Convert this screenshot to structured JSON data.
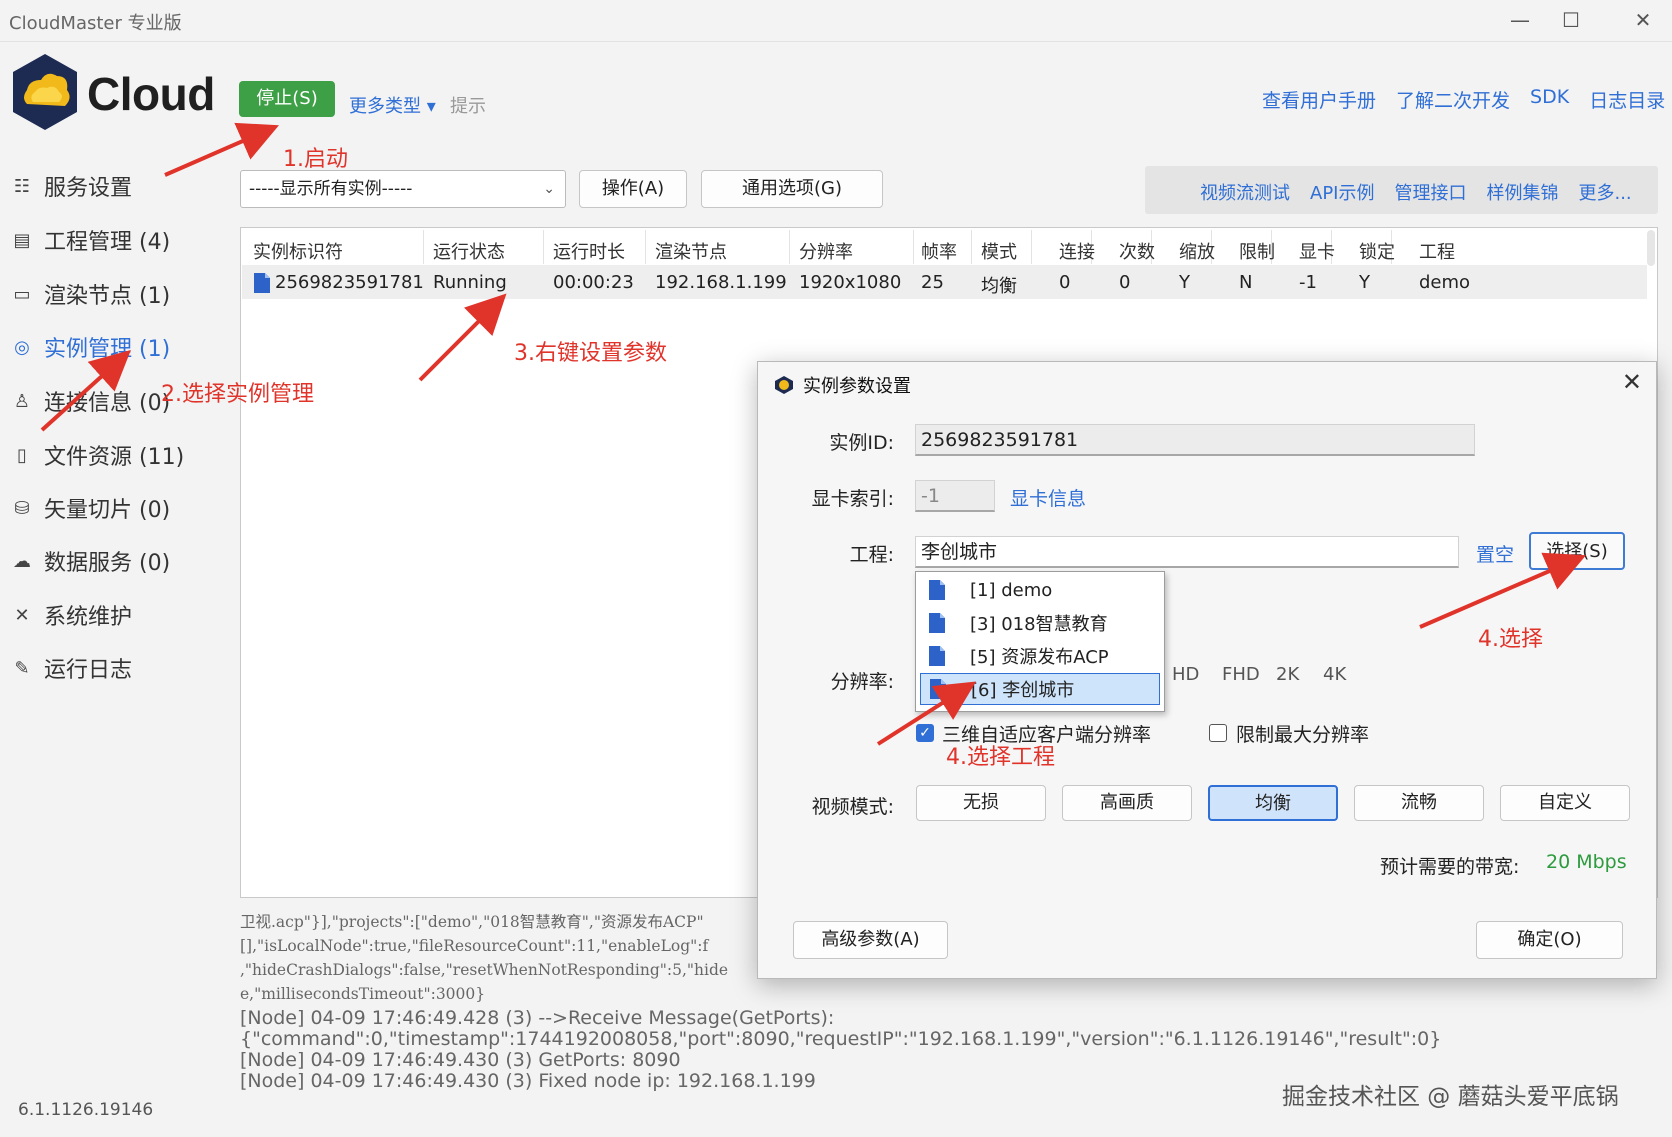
{
  "window": {
    "title": "CloudMaster 专业版",
    "controls": {
      "minimize": "—",
      "maximize": "☐",
      "close": "✕"
    }
  },
  "header": {
    "logo_text": "Cloud",
    "stop_label": "停止(S)",
    "more_types": "更多类型 ▾",
    "hint": "提示",
    "links": [
      "查看用户手册",
      "了解二次开发",
      "SDK",
      "日志目录"
    ]
  },
  "sidebar": {
    "items": [
      {
        "label": "服务设置",
        "icon": "settings-list-icon"
      },
      {
        "label": "工程管理 (4)",
        "icon": "document-icon"
      },
      {
        "label": "渲染节点 (1)",
        "icon": "monitor-icon"
      },
      {
        "label": "实例管理 (1)",
        "icon": "instance-icon",
        "active": true
      },
      {
        "label": "连接信息 (0)",
        "icon": "user-icon"
      },
      {
        "label": "文件资源 (11)",
        "icon": "file-icon"
      },
      {
        "label": "矢量切片 (0)",
        "icon": "database-icon"
      },
      {
        "label": "数据服务 (0)",
        "icon": "cloud-service-icon"
      },
      {
        "label": "系统维护",
        "icon": "tools-icon"
      },
      {
        "label": "运行日志",
        "icon": "log-icon"
      }
    ],
    "version": "6.1.1126.19146"
  },
  "toolbar": {
    "instance_filter": "-----显示所有实例-----",
    "ops_label": "操作(A)",
    "general_label": "通用选项(G)",
    "right_links": [
      "视频流测试",
      "API示例",
      "管理接口",
      "样例集锦",
      "更多..."
    ]
  },
  "table": {
    "headers": [
      "实例标识符",
      "运行状态",
      "运行时长",
      "渲染节点",
      "分辨率",
      "帧率",
      "模式",
      "连接",
      "次数",
      "缩放",
      "限制",
      "显卡",
      "锁定",
      "工程"
    ],
    "rows": [
      [
        "2569823591781",
        "Running",
        "00:00:23",
        "192.168.1.199",
        "1920x1080",
        "25",
        "均衡",
        "0",
        "0",
        "Y",
        "N",
        "-1",
        "Y",
        "demo"
      ]
    ]
  },
  "log": {
    "lines": [
      "卫视.acp\"}],\"projects\":[\"demo\",\"018智慧教育\",\"资源发布ACP\"",
      "[],\"isLocalNode\":true,\"fileResourceCount\":11,\"enableLog\":f",
      ",\"hideCrashDialogs\":false,\"resetWhenNotResponding\":5,\"hide",
      "e,\"millisecondsTimeout\":3000}",
      "[Node] 04-09 17:46:49.428 (3) -->Receive Message(GetPorts):",
      "{\"command\":0,\"timestamp\":1744192008058,\"port\":8090,\"requestIP\":\"192.168.1.199\",\"version\":\"6.1.1126.19146\",\"result\":0}",
      "[Node] 04-09 17:46:49.430 (3) GetPorts: 8090",
      "[Node] 04-09 17:46:49.430 (3) Fixed node ip: 192.168.1.199"
    ]
  },
  "watermark": "掘金技术社区 @ 蘑菇头爱平底锅",
  "dialog": {
    "title": "实例参数设置",
    "close": "✕",
    "instance_id_label": "实例ID:",
    "instance_id": "2569823591781",
    "gpu_index_label": "显卡索引:",
    "gpu_index": "-1",
    "gpu_info_link": "显卡信息",
    "project_label": "工程:",
    "project_value": "李创城市",
    "clear_link": "置空",
    "choose_label": "选择(S)",
    "resolution_label": "分辨率:",
    "resolution_chips": [
      "HD",
      "FHD",
      "2K",
      "4K"
    ],
    "adaptive_label": "三维自适应客户端分辨率",
    "adaptive_checked": true,
    "limit_label": "限制最大分辨率",
    "limit_checked": false,
    "video_mode_label": "视频模式:",
    "video_modes": [
      "无损",
      "高画质",
      "均衡",
      "流畅",
      "自定义"
    ],
    "video_mode_selected": "均衡",
    "bandwidth_label": "预计需要的带宽:",
    "bandwidth_value": "20 Mbps",
    "advanced_label": "高级参数(A)",
    "ok_label": "确定(O)"
  },
  "project_dropdown": {
    "items": [
      "[1] demo",
      "[3] 018智慧教育",
      "[5] 资源发布ACP",
      "[6] 李创城市"
    ],
    "selected": "[6] 李创城市"
  },
  "annotations": [
    "1.启动",
    "2.选择实例管理",
    "3.右键设置参数",
    "4.选择",
    "4.选择工程"
  ],
  "colors": {
    "accent": "#2f6fd6",
    "start_button": "#3ea046",
    "annotation": "#e0342b",
    "bandwidth": "#2e9b3e"
  }
}
